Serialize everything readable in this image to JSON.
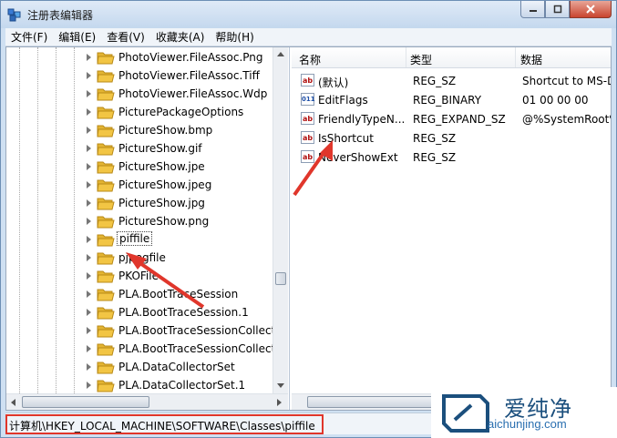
{
  "window": {
    "title": "注册表编辑器",
    "controls": {
      "minimize": "minimize",
      "maximize": "maximize",
      "close": "close"
    }
  },
  "menu": [
    {
      "label": "文件(F)"
    },
    {
      "label": "编辑(E)"
    },
    {
      "label": "查看(V)"
    },
    {
      "label": "收藏夹(A)"
    },
    {
      "label": "帮助(H)"
    }
  ],
  "tree": {
    "nodes": [
      {
        "label": "PhotoViewer.FileAssoc.Png"
      },
      {
        "label": "PhotoViewer.FileAssoc.Tiff"
      },
      {
        "label": "PhotoViewer.FileAssoc.Wdp"
      },
      {
        "label": "PicturePackageOptions"
      },
      {
        "label": "PictureShow.bmp"
      },
      {
        "label": "PictureShow.gif"
      },
      {
        "label": "PictureShow.jpe"
      },
      {
        "label": "PictureShow.jpeg"
      },
      {
        "label": "PictureShow.jpg"
      },
      {
        "label": "PictureShow.png"
      },
      {
        "label": "piffile",
        "selected": true
      },
      {
        "label": "pjpegfile"
      },
      {
        "label": "PKOFile"
      },
      {
        "label": "PLA.BootTraceSession"
      },
      {
        "label": "PLA.BootTraceSession.1"
      },
      {
        "label": "PLA.BootTraceSessionCollect"
      },
      {
        "label": "PLA.BootTraceSessionCollect"
      },
      {
        "label": "PLA.DataCollectorSet"
      },
      {
        "label": "PLA.DataCollectorSet.1"
      }
    ]
  },
  "list": {
    "columns": {
      "name": "名称",
      "type": "类型",
      "data": "数据"
    },
    "rows": [
      {
        "icon": "string-value-icon",
        "badge": "ab",
        "name": "(默认)",
        "type": "REG_SZ",
        "data": "Shortcut to MS-D"
      },
      {
        "icon": "binary-value-icon",
        "badge": "011",
        "name": "EditFlags",
        "type": "REG_BINARY",
        "data": "01 00 00 00"
      },
      {
        "icon": "string-value-icon",
        "badge": "ab",
        "name": "FriendlyTypeN...",
        "type": "REG_EXPAND_SZ",
        "data": "@%SystemRoot%"
      },
      {
        "icon": "string-value-icon",
        "badge": "ab",
        "name": "IsShortcut",
        "type": "REG_SZ",
        "data": ""
      },
      {
        "icon": "string-value-icon",
        "badge": "ab",
        "name": "NeverShowExt",
        "type": "REG_SZ",
        "data": ""
      }
    ]
  },
  "status": {
    "path": "计算机\\HKEY_LOCAL_MACHINE\\SOFTWARE\\Classes\\piffile"
  },
  "watermark": {
    "brand": "爱纯净",
    "url": "aichunjing.com"
  },
  "colors": {
    "annotation": "#e0362b",
    "folder": "#f2c544",
    "brand": "#1b4f7d"
  }
}
